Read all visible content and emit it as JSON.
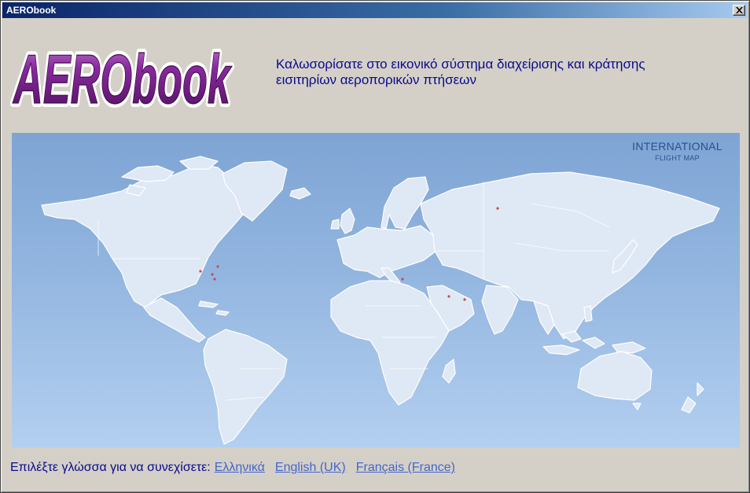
{
  "window": {
    "title": "AERObook",
    "close_symbol": "×"
  },
  "logo": {
    "text": "AERObook"
  },
  "welcome": {
    "line1": "Καλωσορίσατε στο εικονικό σύστημα διαχείρισης και κράτησης",
    "line2": "εισιτηρίων αεροπορικών πτήσεων"
  },
  "map": {
    "title": "INTERNATIONAL",
    "subtitle": "FLIGHT MAP"
  },
  "language": {
    "prompt": "Επιλέξτε γλώσσα για να συνεχίσετε:",
    "options": [
      "Ελληνικά",
      "English (UK)",
      "Français (France)"
    ]
  },
  "colors": {
    "titlebar": "#0a246a",
    "logo_purple": "#6b1a7d",
    "welcome_text": "#0a0a8c",
    "link": "#4466cc",
    "map_background": "#93b6e0",
    "land": "#dfe8f5"
  }
}
